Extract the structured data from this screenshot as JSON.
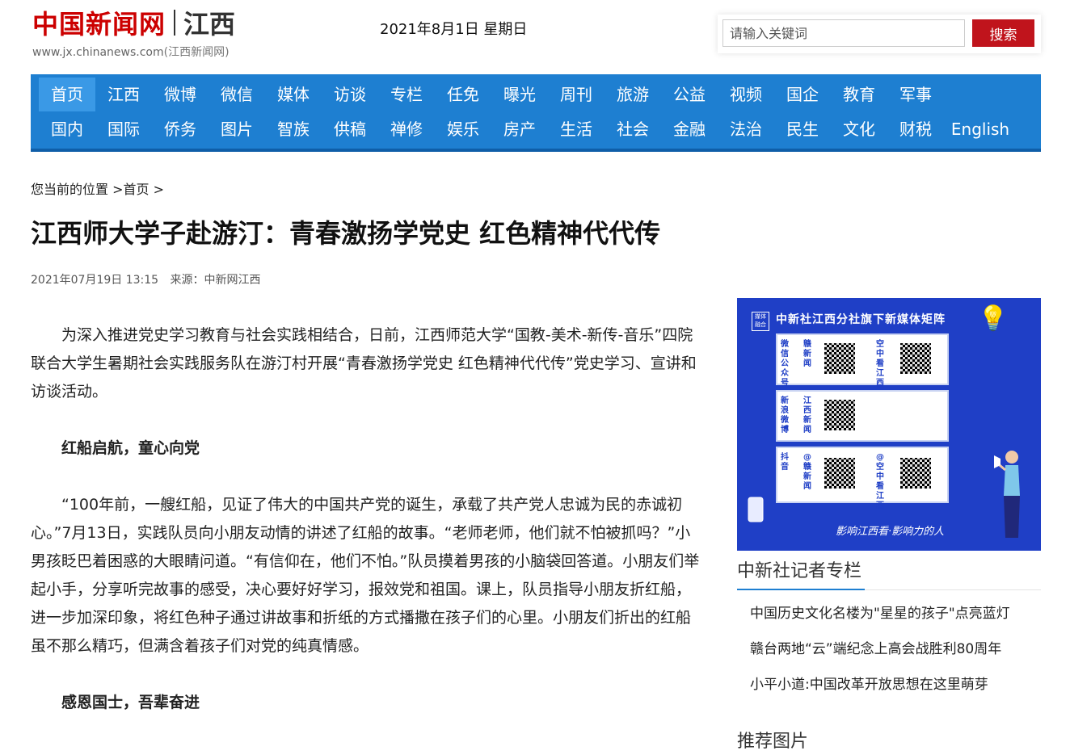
{
  "header": {
    "logo_cn": "中国新闻网",
    "logo_region": "江西",
    "logo_url": "www.jx.chinanews.com",
    "logo_url_suffix": "(江西新闻网)",
    "date": "2021年8月1日 星期日",
    "search_placeholder": "请输入关键词",
    "search_button": "搜索"
  },
  "nav": {
    "row1": [
      "首页",
      "江西",
      "微博",
      "微信",
      "媒体",
      "访谈",
      "专栏",
      "任免",
      "曝光",
      "周刊",
      "旅游",
      "公益",
      "视频",
      "国企",
      "教育",
      "军事"
    ],
    "row2": [
      "国内",
      "国际",
      "侨务",
      "图片",
      "智族",
      "供稿",
      "禅修",
      "娱乐",
      "房产",
      "生活",
      "社会",
      "金融",
      "法治",
      "民生",
      "文化",
      "财税",
      "English"
    ],
    "active": "首页"
  },
  "breadcrumb": {
    "prefix": "您当前的位置",
    "sep1": ">",
    "home": "首页",
    "sep2": ">"
  },
  "article": {
    "title": "江西师大学子赴游汀：青春激扬学党史 红色精神代代传",
    "datetime": "2021年07月19日 13:15",
    "source": "来源：中新网江西",
    "paragraphs": [
      {
        "type": "text",
        "text": "为深入推进党史学习教育与社会实践相结合，日前，江西师范大学“国教-美术-新传-音乐”四院联合大学生暑期社会实践服务队在游汀村开展“青春激扬学党史 红色精神代代传”党史学习、宣讲和访谈活动。"
      },
      {
        "type": "sub",
        "text": "红船启航，童心向党"
      },
      {
        "type": "text",
        "text": "“100年前，一艘红船，见证了伟大的中国共产党的诞生，承载了共产党人忠诚为民的赤诚初心。”7月13日，实践队员向小朋友动情的讲述了红船的故事。“老师老师，他们就不怕被抓吗？”小男孩眨巴着困惑的大眼睛问道。“有信仰在，他们不怕。”队员摸着男孩的小脑袋回答道。小朋友们举起小手，分享听完故事的感受，决心要好好学习，报效党和祖国。课上，队员指导小朋友折红船，进一步加深印象，将红色种子通过讲故事和折纸的方式播撒在孩子们的心里。小朋友们折出的红船虽不那么精巧，但满含着孩子们对党的纯真情感。"
      },
      {
        "type": "sub",
        "text": "感恩国士，吾辈奋进"
      }
    ]
  },
  "sidebar": {
    "banner": {
      "tag": "媒体融合",
      "title": "中新社江西分社旗下新媒体矩阵",
      "card1_label": "微信公众号",
      "card1_label2": "赣新闻",
      "card1_label3": "空中看江西",
      "card2_label": "新浪微博",
      "card2_label2": "江西新闻",
      "card3_label": "抖音",
      "card3_label2": "@赣新闻",
      "card3_label3": "@空中看江西",
      "slogan": "影响江西看·影响力的人",
      "colors": {
        "bg": "#1f3fc6",
        "accent": "#ffd84a"
      }
    },
    "reporters_title": "中新社记者专栏",
    "reporters": [
      "中国历史文化名楼为\"星星的孩子\"点亮蓝灯",
      "赣台两地“云”端纪念上高会战胜利80周年",
      "小平小道:中国改革开放思想在这里萌芽"
    ],
    "recommended_title": "推荐图片"
  }
}
